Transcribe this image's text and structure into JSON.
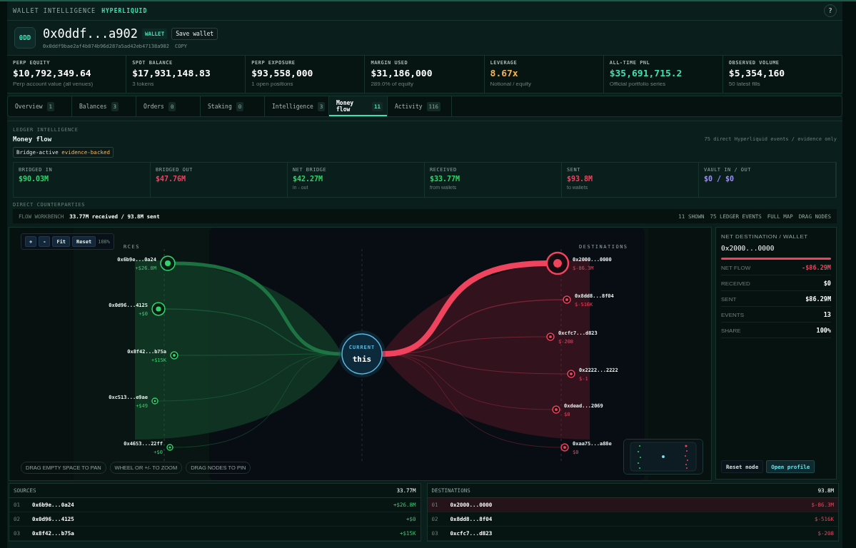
{
  "header": {
    "kicker": "WALLET INTELLIGENCE",
    "brand": "HYPERLIQUID",
    "help": "?"
  },
  "wallet": {
    "avatar": "0DD",
    "address_short": "0x0ddf...a902",
    "type_badge": "WALLET",
    "save_button": "Save wallet",
    "address_full": "0x0ddf9bae2af4b874b96d287a5ad42eb47138a902",
    "copy": "COPY"
  },
  "stats": [
    {
      "label": "PERP EQUITY",
      "value": "$10,792,349.64",
      "note": "Perp account value (all venues)",
      "color": "#ffffff"
    },
    {
      "label": "SPOT BALANCE",
      "value": "$17,931,148.83",
      "note": "3 tokens",
      "color": "#ffffff"
    },
    {
      "label": "PERP EXPOSURE",
      "value": "$93,558,000",
      "note": "1 open positions",
      "color": "#ffffff"
    },
    {
      "label": "MARGIN USED",
      "value": "$31,186,000",
      "note": "289.0% of equity",
      "color": "#ffffff"
    },
    {
      "label": "LEVERAGE",
      "value": "8.67x",
      "note": "Notional / equity",
      "color": "#f2b35a"
    },
    {
      "label": "ALL-TIME PNL",
      "value": "$35,691,715.2",
      "note": "Official portfolio series",
      "color": "#3fe0b2"
    },
    {
      "label": "OBSERVED VOLUME",
      "value": "$5,354,160",
      "note": "50 latest fills",
      "color": "#ffffff"
    }
  ],
  "tabs": [
    {
      "label": "Overview",
      "count": "1",
      "selected": false
    },
    {
      "label": "Balances",
      "count": "3",
      "selected": false
    },
    {
      "label": "Orders",
      "count": "0",
      "selected": false
    },
    {
      "label": "Staking",
      "count": "0",
      "selected": false
    },
    {
      "label": "Intelligence",
      "count": "3",
      "selected": false
    },
    {
      "label": "Money flow",
      "count": "11",
      "selected": true
    },
    {
      "label": "Activity",
      "count": "116",
      "selected": false
    }
  ],
  "money_flow": {
    "kicker": "LEDGER INTELLIGENCE",
    "title": "Money flow",
    "note": "75 direct Hyperliquid events / evidence only",
    "badge": {
      "label": "Bridge-active",
      "status": "evidence-backed"
    },
    "metrics": [
      {
        "label": "BRIDGED IN",
        "value": "$90.03M",
        "color": "#2fd46b"
      },
      {
        "label": "BRIDGED OUT",
        "value": "$47.76M",
        "color": "#f0435e"
      },
      {
        "label": "NET BRIDGE",
        "value": "$42.27M",
        "note": "in - out",
        "color": "#2fd46b"
      },
      {
        "label": "RECEIVED",
        "value": "$33.77M",
        "note": "from wallets",
        "color": "#2fd46b"
      },
      {
        "label": "SENT",
        "value": "$93.8M",
        "note": "to wallets",
        "color": "#f0435e"
      },
      {
        "label": "VAULT IN / OUT",
        "value": "$0 / $0",
        "color": "#9d8cff"
      }
    ],
    "section_label": "DIRECT COUNTERPARTIES"
  },
  "workbench": {
    "label": "FLOW WORKBENCH",
    "summary": "33.77M received / 93.8M sent",
    "chips": [
      "11 SHOWN",
      "75 LEDGER EVENTS",
      "FULL MAP",
      "DRAG NODES"
    ]
  },
  "graph": {
    "controls": [
      "+",
      "-",
      "Fit",
      "Reset"
    ],
    "zoom": "100%",
    "sources_heading": "RCES",
    "destinations_heading": "DESTINATIONS",
    "center": {
      "kicker": "CURRENT",
      "label": "this"
    },
    "sources": [
      {
        "label": "0x6b9e...0a24",
        "amount": "+$26.8M"
      },
      {
        "label": "0x0d96...4125",
        "amount": "+$0"
      },
      {
        "label": "0x8f42...b75a",
        "amount": "+$15K"
      },
      {
        "label": "0xc513...e9ae",
        "amount": "+$49"
      },
      {
        "label": "0x4653...22ff",
        "amount": "+$0"
      }
    ],
    "destinations": [
      {
        "label": "0x2000...0000",
        "amount": "$-86.3M",
        "selected": true
      },
      {
        "label": "0x8dd8...8f04",
        "amount": "$-516K",
        "selected": false
      },
      {
        "label": "0xcfc7...d823",
        "amount": "$-208",
        "selected": false
      },
      {
        "label": "0x2222...2222",
        "amount": "$-1",
        "selected": false
      },
      {
        "label": "0xdead...2069",
        "amount": "$0",
        "selected": false
      },
      {
        "label": "0xaa75...a88e",
        "amount": "$0",
        "selected": false
      }
    ],
    "hints": [
      "DRAG EMPTY SPACE TO PAN",
      "WHEEL OR +/- TO ZOOM",
      "DRAG NODES TO PIN"
    ]
  },
  "detail": {
    "kicker": "NET DESTINATION / WALLET",
    "address": "0x2000...0000",
    "level": 1,
    "rows": [
      {
        "label": "NET FLOW",
        "value": "-$86.29M",
        "color": "#f0435e"
      },
      {
        "label": "RECEIVED",
        "value": "$0",
        "color": "#ffffff"
      },
      {
        "label": "SENT",
        "value": "$86.29M",
        "color": "#ffffff"
      },
      {
        "label": "EVENTS",
        "value": "13",
        "color": "#ffffff"
      },
      {
        "label": "SHARE",
        "value": "100%",
        "color": "#ffffff"
      }
    ],
    "buttons": [
      "Reset node",
      "Open profile"
    ]
  },
  "sources_table": {
    "title": "SOURCES",
    "total": "33.77M",
    "rows": [
      {
        "index": "01",
        "address": "0x6b9e...0a24",
        "amount": "+$26.8M"
      },
      {
        "index": "02",
        "address": "0x0d96...4125",
        "amount": "+$0"
      },
      {
        "index": "03",
        "address": "0x8f42...b75a",
        "amount": "+$15K"
      }
    ]
  },
  "destinations_table": {
    "title": "DESTINATIONS",
    "total": "93.8M",
    "rows": [
      {
        "index": "01",
        "address": "0x2000...0000",
        "amount": "$-86.3M",
        "selected": true
      },
      {
        "index": "02",
        "address": "0x8dd8...8f04",
        "amount": "$-516K",
        "selected": false
      },
      {
        "index": "03",
        "address": "0xcfc7...d823",
        "amount": "$-208",
        "selected": false
      }
    ]
  }
}
